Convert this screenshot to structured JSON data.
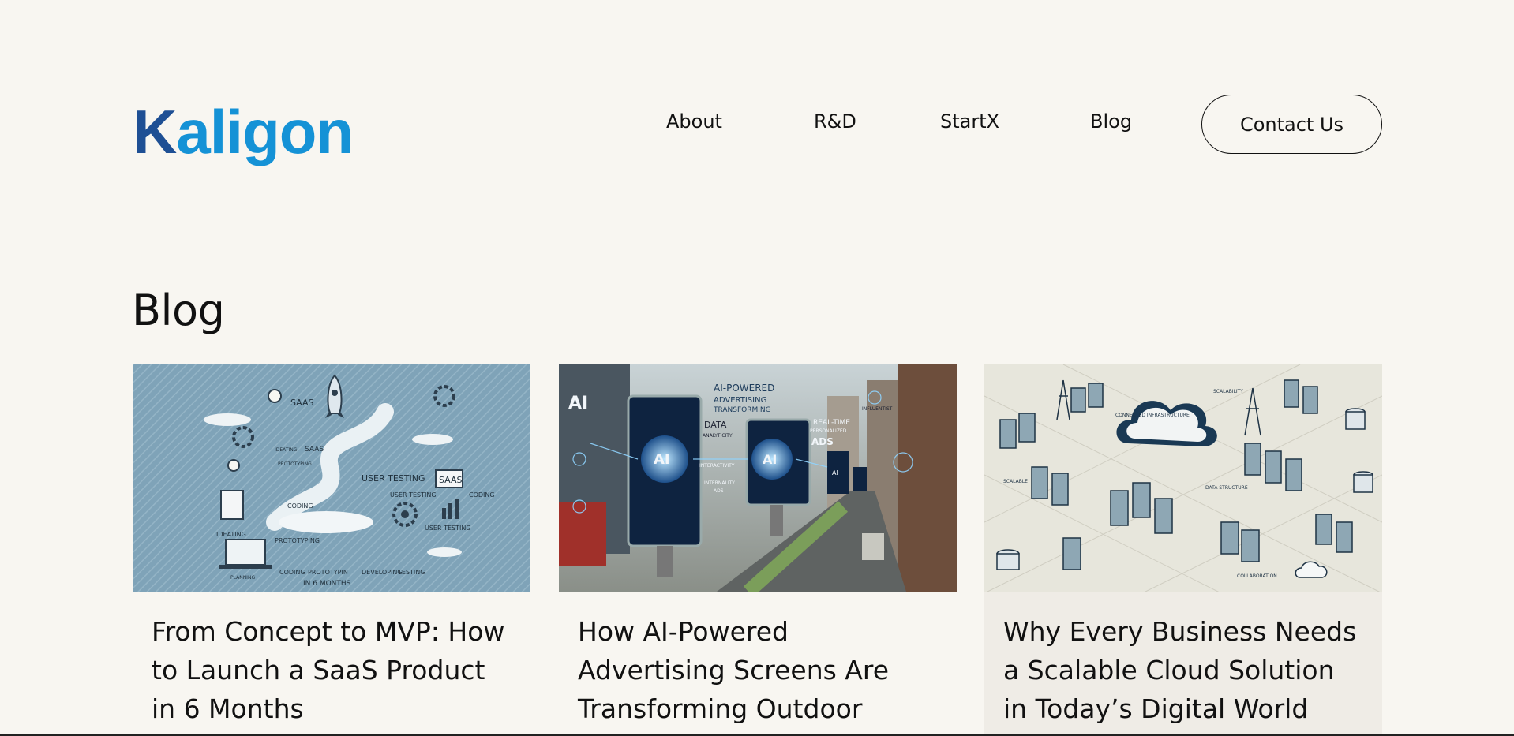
{
  "brand": {
    "logo_first": "K",
    "logo_rest": "aligon",
    "colors": {
      "dark": "#1e4f94",
      "light": "#1592d6"
    }
  },
  "nav": {
    "items": [
      {
        "label": "About"
      },
      {
        "label": "R&D"
      },
      {
        "label": "StartX"
      },
      {
        "label": "Blog"
      }
    ],
    "cta_label": "Contact Us"
  },
  "main": {
    "heading": "Blog",
    "posts": [
      {
        "title": "From Concept to MVP: How to Launch a SaaS Product in 6 Months",
        "image_labels": [
          "SAAS",
          "SAAS",
          "USER TESTING",
          "SAAS",
          "USER TESTING",
          "CODING",
          "CODING",
          "IDEATING",
          "PROTOTYPING",
          "CODING",
          "PROTOTYPIN",
          "DEVELOPING",
          "TESTING",
          "USER TESTING",
          "PLANNING",
          "IN 6 MONTHS",
          "IDEATING",
          "PROTOTYPING"
        ]
      },
      {
        "title": "How AI-Powered Advertising Screens Are Transforming Outdoor Marketing",
        "image_labels": [
          "AI",
          "AI-POWERED",
          "ADVERTISING",
          "TRANSFORMING",
          "DATA",
          "ANALYTICITY",
          "REAL-TIME",
          "PERSONALIZED",
          "ADS",
          "AI",
          "AI",
          "INTERACTIVITY",
          "INTERNALITY",
          "ADS",
          "AI",
          "INFLUENTIST"
        ]
      },
      {
        "title": "Why Every Business Needs a Scalable Cloud Solution in Today’s Digital World",
        "image_labels": [
          "SCALABLE",
          "CONNECTED INFRASTRUCTURE",
          "DATA STRUCTURE",
          "COLLABORATION",
          "SCALABILITY"
        ]
      }
    ]
  }
}
